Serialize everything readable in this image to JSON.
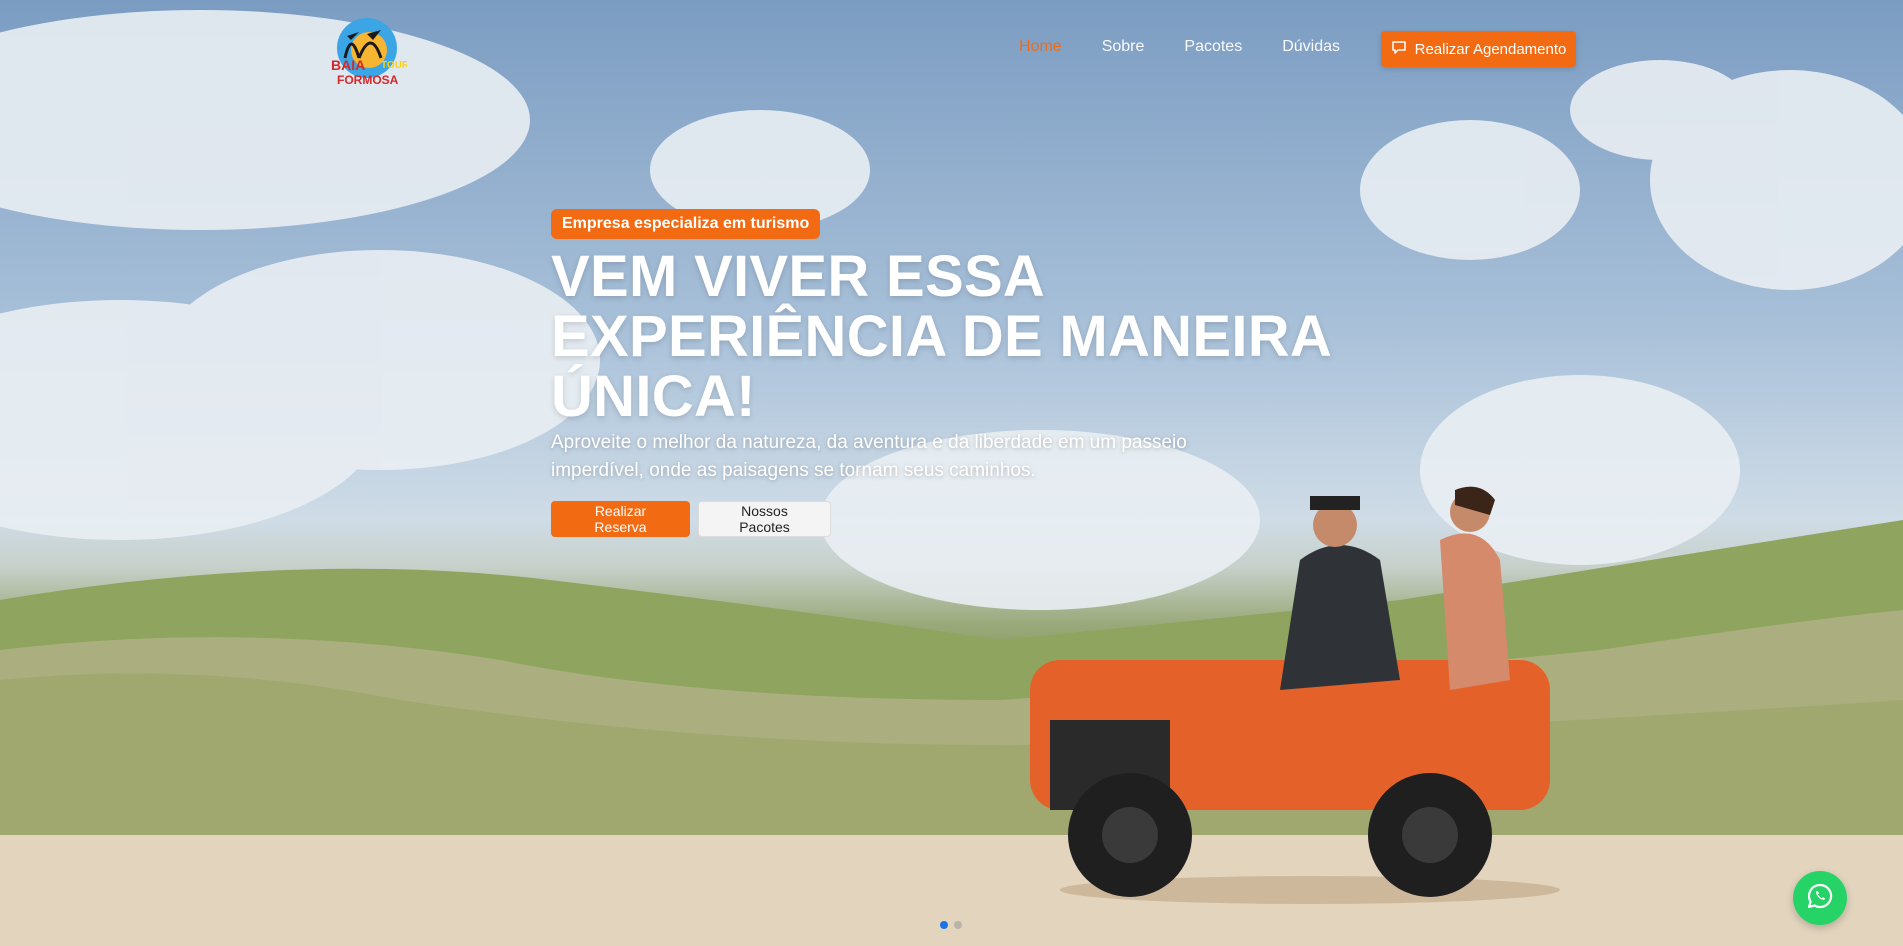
{
  "nav": {
    "logo_alt": "Baia Formosa Tour",
    "links": [
      {
        "label": "Home",
        "active": true
      },
      {
        "label": "Sobre",
        "active": false
      },
      {
        "label": "Pacotes",
        "active": false
      },
      {
        "label": "Dúvidas",
        "active": false
      }
    ],
    "cta": {
      "label": "Realizar Agendamento",
      "icon": "chat-icon"
    }
  },
  "hero": {
    "badge": "Empresa especializa em turismo",
    "headline_lines": [
      "VEM VIVER ESSA",
      "EXPERIÊNCIA DE MANEIRA",
      "ÚNICA!"
    ],
    "subtitle_lines": [
      "Aproveite o melhor da natureza, da aventura e da liberdade em um passeio",
      "imperdível, onde as paisagens se tornam seus caminhos."
    ],
    "primary_button": "Realizar Reserva",
    "secondary_button": "Nossos Pacotes"
  },
  "carousel": {
    "slides": 2,
    "active_index": 0
  },
  "floating": {
    "whatsapp_icon": "whatsapp-icon"
  },
  "colors": {
    "accent": "#f26a12",
    "whatsapp": "#25d366",
    "dot_active": "#1a73e8"
  }
}
